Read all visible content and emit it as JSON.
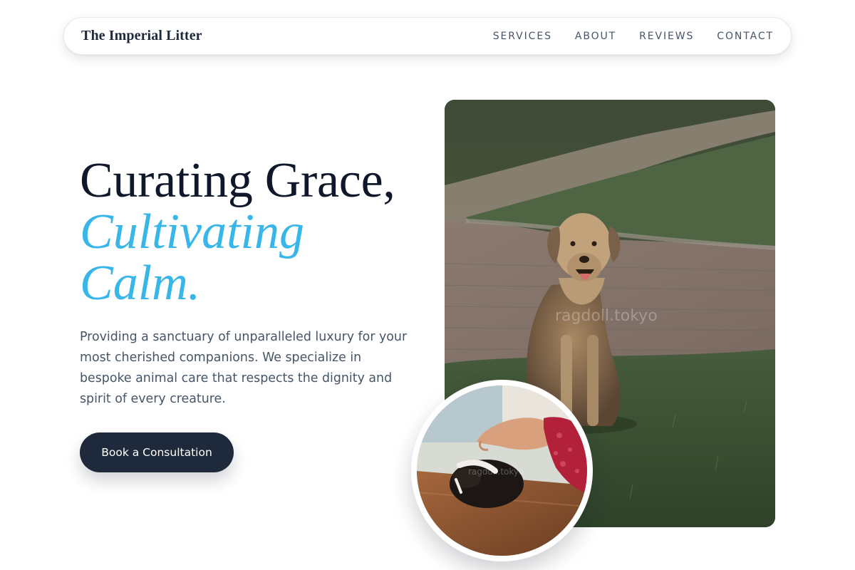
{
  "nav": {
    "brand": "The Imperial Litter",
    "links": [
      "SERVICES",
      "ABOUT",
      "REVIEWS",
      "CONTACT"
    ]
  },
  "hero": {
    "title_line1": "Curating Grace,",
    "title_line2": "Cultivating",
    "title_line3": "Calm.",
    "description": "Providing a sanctuary of unparalleled luxury for your most cherished companions. We specialize in bespoke animal care that respects the dignity and spirit of every creature.",
    "cta_label": "Book a Consultation"
  },
  "images": {
    "main_watermark": "ragdoll.tokyo",
    "inset_watermark": "ragdoll.tokyo"
  },
  "colors": {
    "accent": "#38b6e9",
    "dark": "#1e293b",
    "text_muted": "#475569"
  }
}
